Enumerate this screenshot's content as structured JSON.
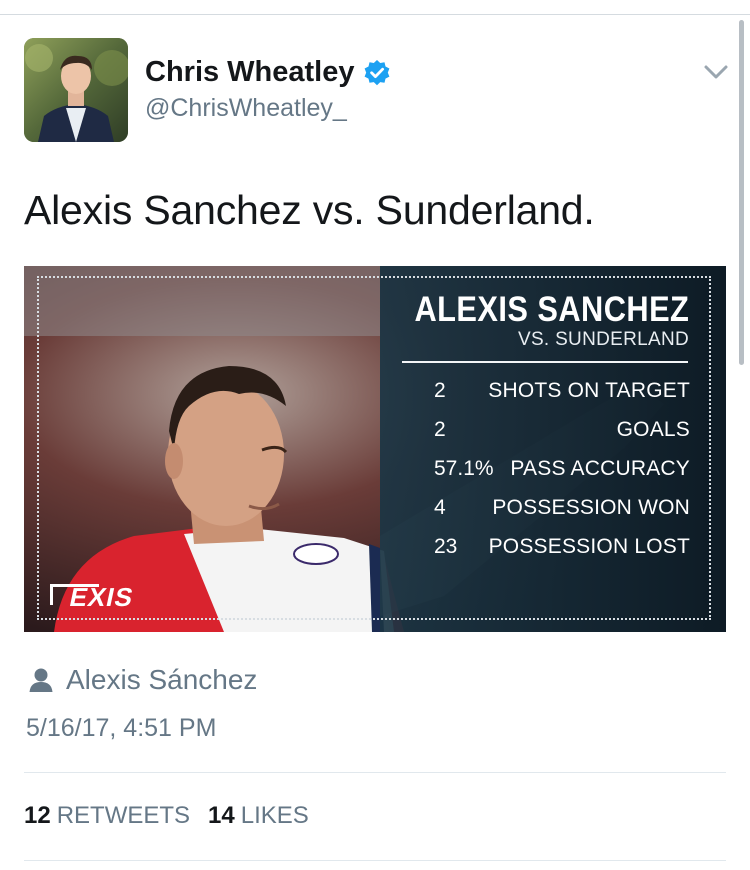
{
  "tweet": {
    "author": {
      "name": "Chris Wheatley",
      "handle": "@ChrisWheatley_",
      "verified": true
    },
    "text": "Alexis Sanchez vs. Sunderland.",
    "media": {
      "title": "ALEXIS SANCHEZ",
      "subtitle": "VS. SUNDERLAND",
      "shirt_text": "EXIS",
      "stats": [
        {
          "value": "2",
          "label": "SHOTS ON TARGET"
        },
        {
          "value": "2",
          "label": "GOALS"
        },
        {
          "value": "57.1%",
          "label": "PASS ACCURACY"
        },
        {
          "value": "4",
          "label": "POSSESSION WON"
        },
        {
          "value": "23",
          "label": "POSSESSION LOST"
        }
      ]
    },
    "place": "Alexis Sánchez",
    "timestamp": "5/16/17, 4:51 PM",
    "retweets": {
      "count": "12",
      "label": "RETWEETS"
    },
    "likes": {
      "count": "14",
      "label": "LIKES"
    }
  },
  "icons": {
    "verified": "verified-badge-icon",
    "menu": "chevron-down-icon",
    "person": "person-icon"
  },
  "colors": {
    "verified_blue": "#1da1f2",
    "text_primary": "#14171a",
    "text_secondary": "#657786",
    "card_bg": "#10202c"
  }
}
